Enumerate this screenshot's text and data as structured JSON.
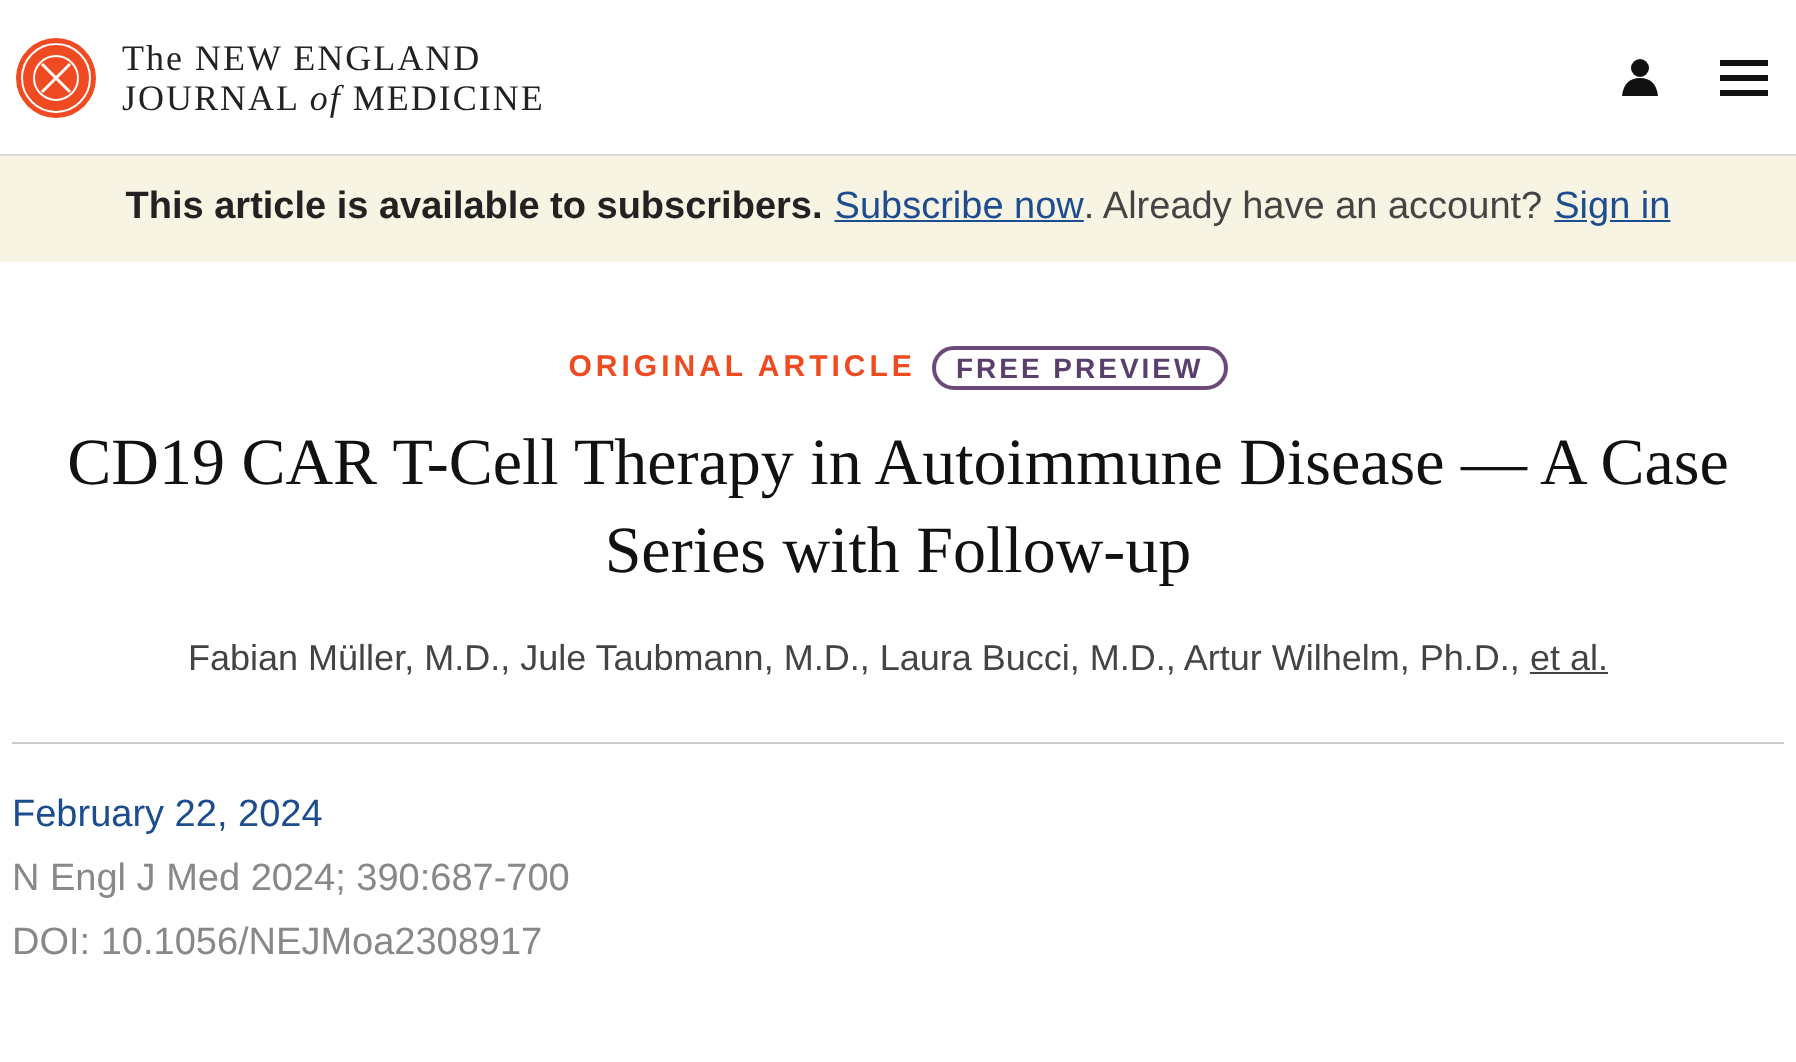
{
  "logo": {
    "line_1": "The NEW ENGLAND",
    "line_2": "JOURNAL *of* MEDICINE"
  },
  "banner": {
    "text": "This article is available to subscribers.",
    "subscribe_link": "Subscribe now",
    "middle": ". Already have an account?",
    "sign_in_link": "Sign in"
  },
  "article": {
    "type": "ORIGINAL ARTICLE",
    "badge": "FREE PREVIEW",
    "title": "CD19 CAR T-Cell Therapy in Autoimmune Disease — A Case Series with Follow-up",
    "authors": "Fabian Müller, M.D., Jule Taubmann, M.D., Laura Bucci, M.D., Artur Wilhelm, Ph.D.,",
    "et_al": "et al."
  },
  "meta": {
    "date": "February 22, 2024",
    "citation": "N Engl J Med 2024; 390:687-700",
    "doi": "DOI: 10.1056/NEJMoa2308917"
  }
}
